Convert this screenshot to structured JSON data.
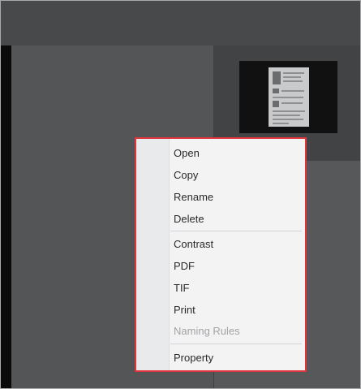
{
  "context_menu": {
    "items": [
      {
        "label": "Open",
        "enabled": true
      },
      {
        "label": "Copy",
        "enabled": true
      },
      {
        "label": "Rename",
        "enabled": true
      },
      {
        "label": "Delete",
        "enabled": true
      },
      {
        "label": "Contrast",
        "enabled": true
      },
      {
        "label": "PDF",
        "enabled": true
      },
      {
        "label": "TIF",
        "enabled": true
      },
      {
        "label": "Print",
        "enabled": true
      },
      {
        "label": "Naming Rules",
        "enabled": false
      },
      {
        "label": "Property",
        "enabled": true
      }
    ],
    "highlight_border_color": "#e0343c"
  },
  "colors": {
    "toolbar": "#48494b",
    "workspace": "#545557",
    "menu_background": "#f3f3f3",
    "disabled_text": "#a2a3a6"
  },
  "thumbnail": {
    "icon": "document-thumbnail"
  }
}
